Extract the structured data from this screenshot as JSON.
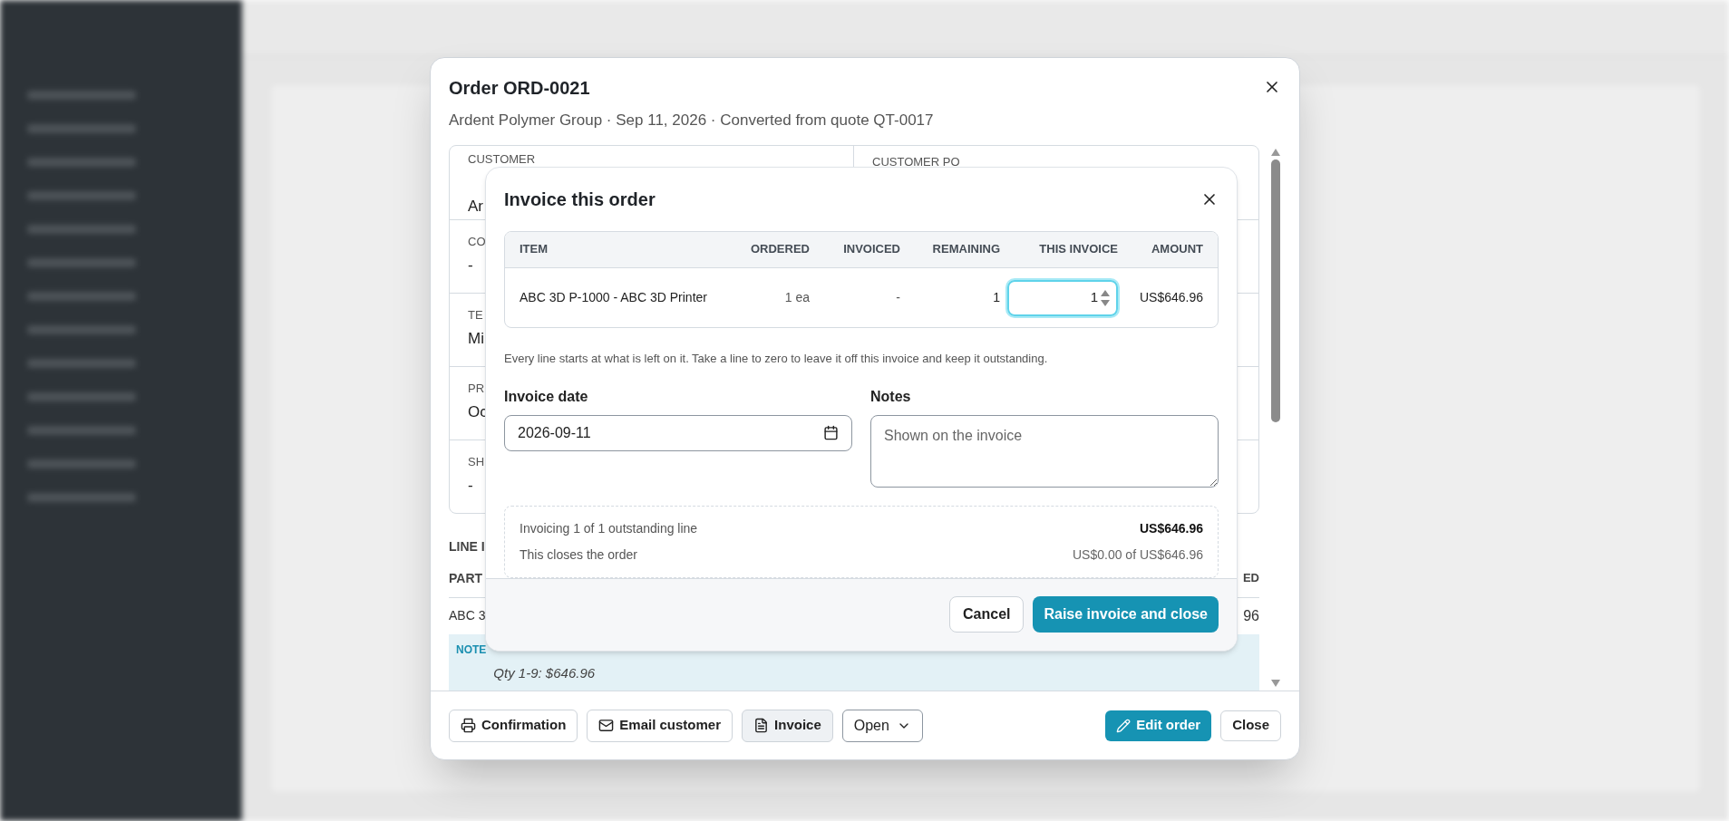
{
  "order_dialog": {
    "title": "Order ORD-0021",
    "subtitle": "Ardent Polymer Group · Sep 11, 2026 · Converted from quote QT-0017",
    "fields": [
      {
        "label": "CUSTOMER",
        "value": "Ar",
        "right_label": "CUSTOMER PO"
      },
      {
        "label": "CO",
        "value": "-"
      },
      {
        "label": "TE",
        "value": "Mi"
      },
      {
        "label": "PR",
        "value": "Oc"
      },
      {
        "label": "SH",
        "value": "-"
      }
    ],
    "line_items": {
      "heading": "LINE I",
      "column_1": "PART",
      "column_last": "ED",
      "row": {
        "part": "ABC 3",
        "amount": "96"
      },
      "note": {
        "label": "NOTE",
        "text": "Qty 1-9: $646.96"
      }
    },
    "actions": [
      {
        "label": "Confirmation",
        "selected": false
      },
      {
        "label": "Email customer",
        "selected": false
      },
      {
        "label": "Invoice",
        "selected": true
      }
    ],
    "status": {
      "value": "Open"
    },
    "edit_button": "Edit order",
    "close_button": "Close"
  },
  "invoice_dialog": {
    "title": "Invoice this order",
    "columns": [
      "ITEM",
      "ORDERED",
      "INVOICED",
      "REMAINING",
      "THIS INVOICE",
      "AMOUNT"
    ],
    "rows": [
      {
        "item": "ABC 3D P-1000 - ABC 3D Printer",
        "ordered": "1 ea",
        "invoiced": "-",
        "remaining": "1",
        "this_invoice": "1",
        "amount": "US$646.96"
      }
    ],
    "hint": "Every line starts at what is left on it. Take a line to zero to leave it off this invoice and keep it outstanding.",
    "invoice_date": {
      "label": "Invoice date",
      "value": "2026-09-11"
    },
    "notes": {
      "label": "Notes",
      "placeholder": "Shown on the invoice"
    },
    "summary": [
      {
        "label": "Invoicing 1 of 1 outstanding line",
        "value": "US$646.96",
        "emphasis": true
      },
      {
        "label": "This closes the order",
        "value": "US$0.00 of US$646.96",
        "emphasis": false
      }
    ],
    "cancel_button": "Cancel",
    "submit_button": "Raise invoice and close"
  }
}
